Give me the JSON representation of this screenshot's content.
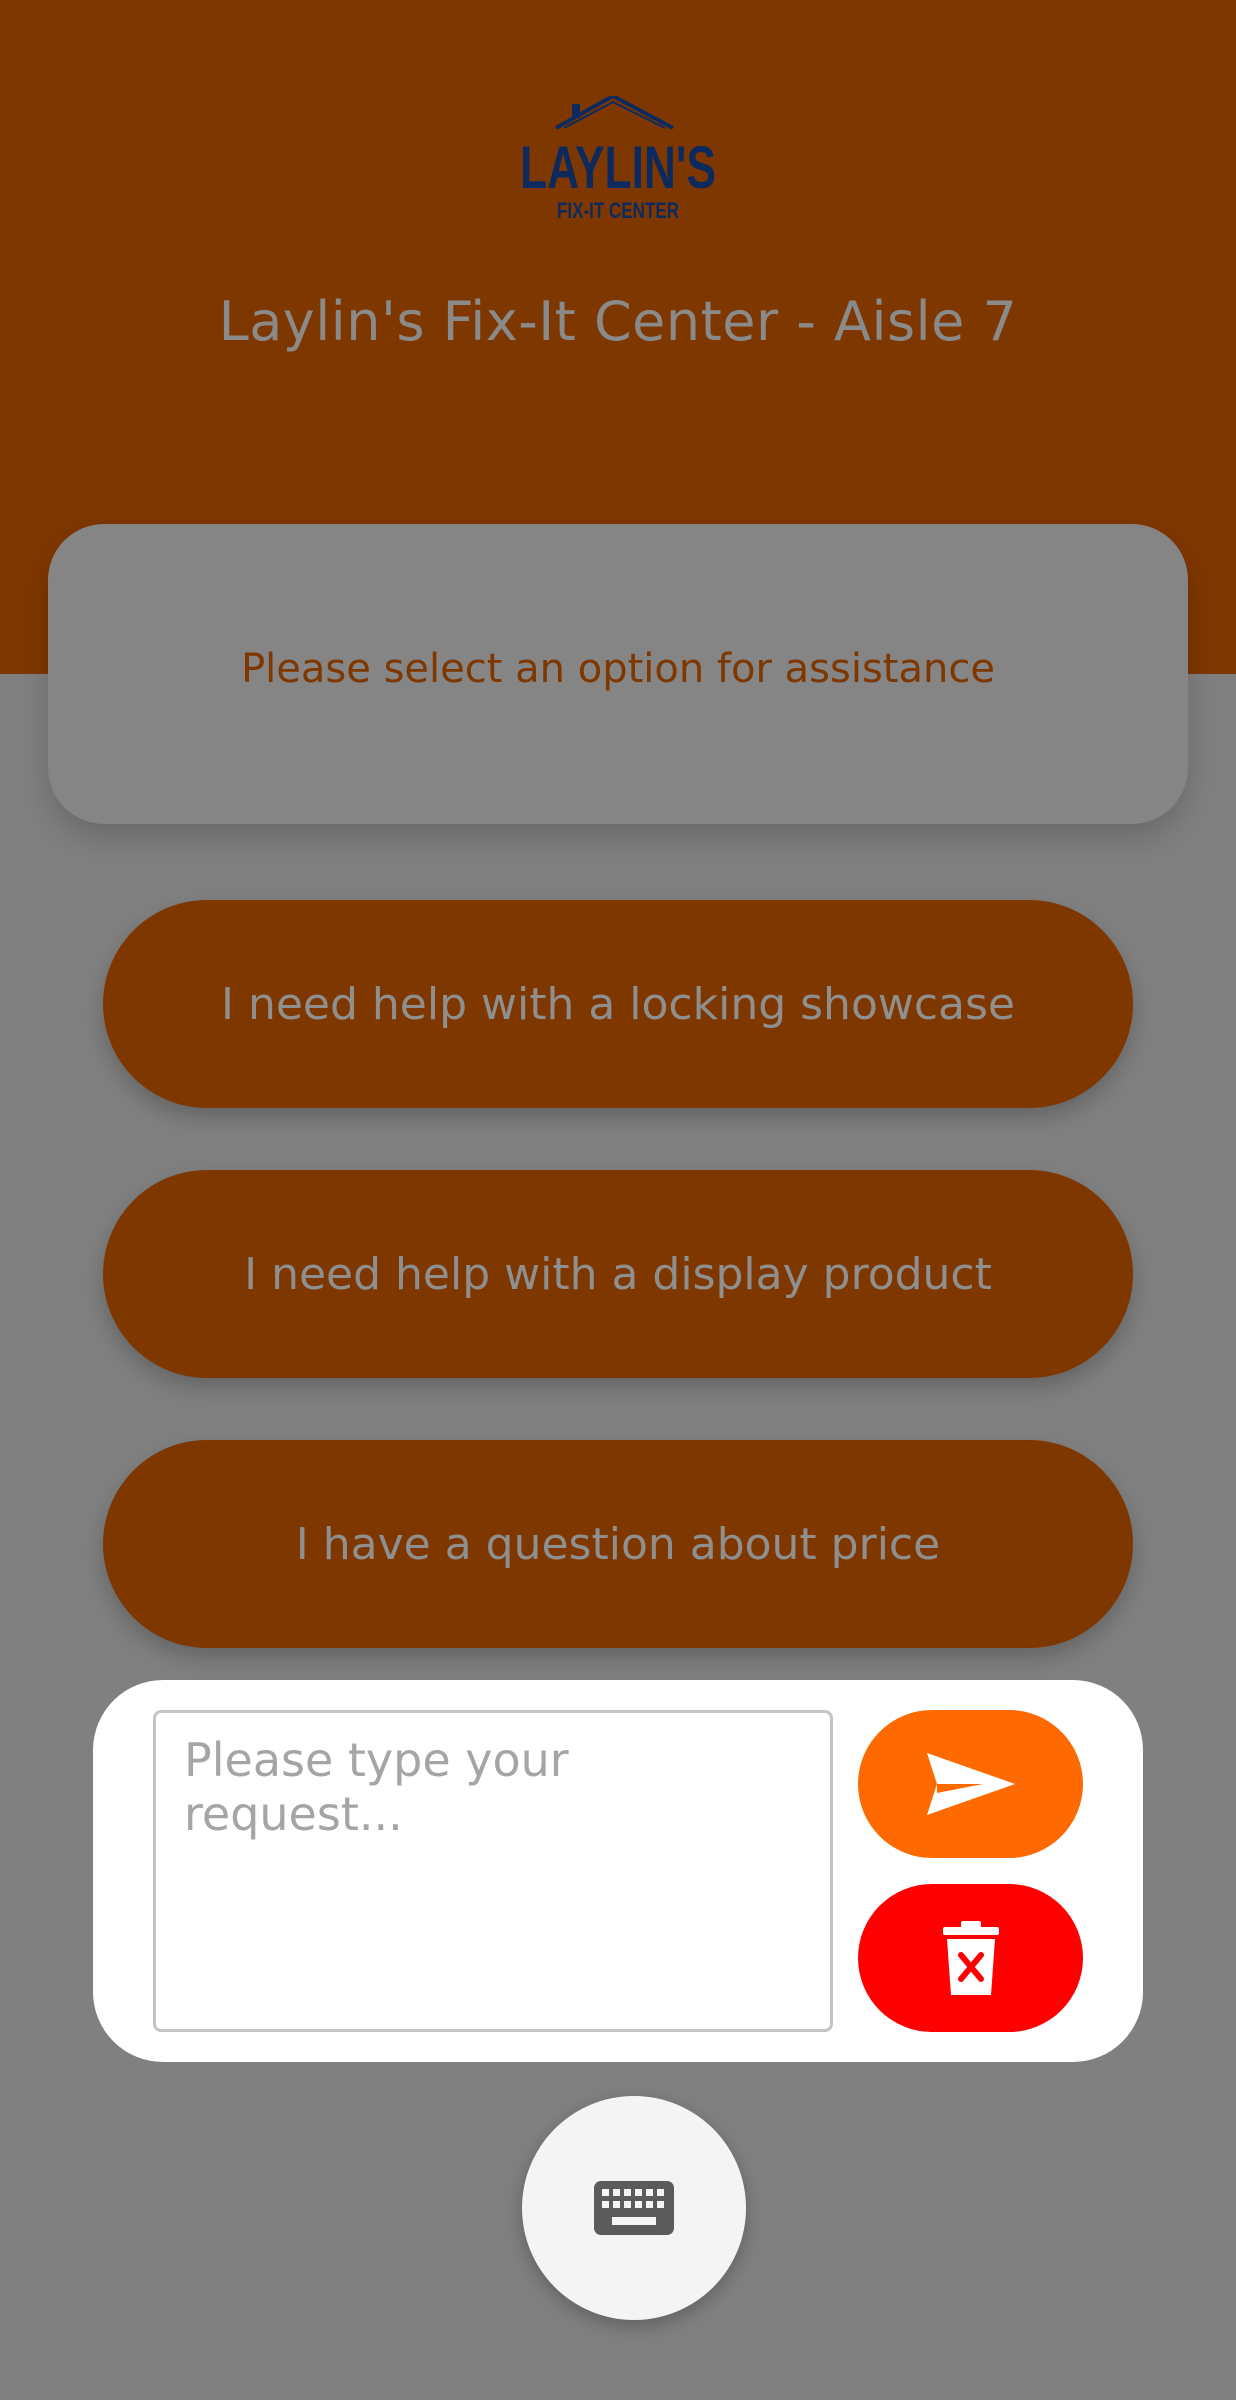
{
  "header": {
    "logo_text_main": "LAYLIN'S",
    "logo_text_sub": "FIX-IT CENTER",
    "store_title": "Laylin's Fix-It Center - Aisle 7"
  },
  "prompt": {
    "text": "Please select an option for assistance"
  },
  "options": [
    {
      "label": "I need help with a locking showcase"
    },
    {
      "label": "I need help with a display product"
    },
    {
      "label": "I have a question about price"
    }
  ],
  "input": {
    "placeholder": "Please type your request...",
    "value": ""
  },
  "icons": {
    "send": "send-icon",
    "clear": "trash-icon",
    "keyboard": "keyboard-icon"
  },
  "colors": {
    "header_bg": "#7f3700",
    "page_bg": "#808080",
    "send_button": "#ff6a00",
    "clear_button": "#ff0000",
    "logo": "#0d2a5e"
  }
}
